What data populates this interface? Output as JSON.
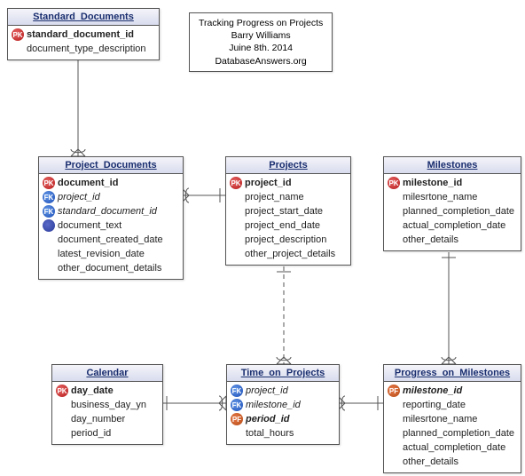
{
  "info": {
    "line1": "Tracking Progress on Projects",
    "line2": "Barry Williams",
    "line3": "Juine 8th. 2014",
    "line4": "DatabaseAnswers.org"
  },
  "entities": {
    "standard_documents": {
      "title": "Standard_Documents",
      "rows": [
        {
          "icon": "pk",
          "label": "PK",
          "text": "standard_document_id",
          "bold": true
        },
        {
          "icon": "none",
          "label": "",
          "text": "document_type_description"
        }
      ]
    },
    "project_documents": {
      "title": "Project_Documents",
      "rows": [
        {
          "icon": "pk",
          "label": "PK",
          "text": "document_id",
          "bold": true
        },
        {
          "icon": "fk",
          "label": "FK",
          "text": "project_id",
          "ital": true
        },
        {
          "icon": "fk",
          "label": "FK",
          "text": "standard_document_id",
          "ital": true
        },
        {
          "icon": "ak",
          "label": "",
          "text": "document_text"
        },
        {
          "icon": "none",
          "label": "",
          "text": "document_created_date"
        },
        {
          "icon": "none",
          "label": "",
          "text": "latest_revision_date"
        },
        {
          "icon": "none",
          "label": "",
          "text": "other_document_details"
        }
      ]
    },
    "projects": {
      "title": "Projects",
      "rows": [
        {
          "icon": "pk",
          "label": "PK",
          "text": "project_id",
          "bold": true
        },
        {
          "icon": "none",
          "label": "",
          "text": "project_name"
        },
        {
          "icon": "none",
          "label": "",
          "text": "project_start_date"
        },
        {
          "icon": "none",
          "label": "",
          "text": "project_end_date"
        },
        {
          "icon": "none",
          "label": "",
          "text": "project_description"
        },
        {
          "icon": "none",
          "label": "",
          "text": "other_project_details"
        }
      ]
    },
    "milestones": {
      "title": "Milestones",
      "rows": [
        {
          "icon": "pk",
          "label": "PK",
          "text": "milestone_id",
          "bold": true
        },
        {
          "icon": "none",
          "label": "",
          "text": "milesrtone_name"
        },
        {
          "icon": "none",
          "label": "",
          "text": "planned_completion_date"
        },
        {
          "icon": "none",
          "label": "",
          "text": "actual_completion_date"
        },
        {
          "icon": "none",
          "label": "",
          "text": "other_details"
        }
      ]
    },
    "calendar": {
      "title": "Calendar",
      "rows": [
        {
          "icon": "pk",
          "label": "PK",
          "text": "day_date",
          "bold": true
        },
        {
          "icon": "none",
          "label": "",
          "text": "business_day_yn"
        },
        {
          "icon": "none",
          "label": "",
          "text": "day_number"
        },
        {
          "icon": "none",
          "label": "",
          "text": "period_id"
        }
      ]
    },
    "time_on_projects": {
      "title": "Time_on_Projects",
      "rows": [
        {
          "icon": "fk",
          "label": "FK",
          "text": "project_id",
          "ital": true
        },
        {
          "icon": "fk",
          "label": "FK",
          "text": "milestone_id",
          "ital": true
        },
        {
          "icon": "pf",
          "label": "PF",
          "text": "period_id",
          "bold": true,
          "ital": true
        },
        {
          "icon": "none",
          "label": "",
          "text": "total_hours"
        }
      ]
    },
    "progress_on_milestones": {
      "title": "Progress_on_Milestones",
      "rows": [
        {
          "icon": "pf",
          "label": "PF",
          "text": "milestone_id",
          "bold": true,
          "ital": true
        },
        {
          "icon": "none",
          "label": "",
          "text": "reporting_date"
        },
        {
          "icon": "none",
          "label": "",
          "text": "milesrtone_name"
        },
        {
          "icon": "none",
          "label": "",
          "text": "planned_completion_date"
        },
        {
          "icon": "none",
          "label": "",
          "text": "actual_completion_date"
        },
        {
          "icon": "none",
          "label": "",
          "text": "other_details"
        }
      ]
    }
  }
}
